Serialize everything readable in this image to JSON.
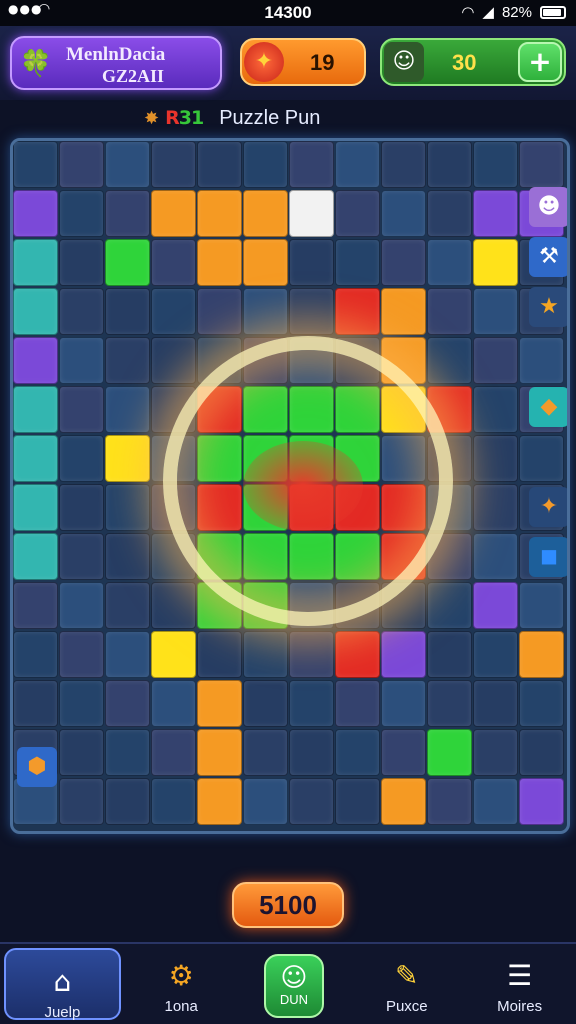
{
  "status_bar": {
    "time": "14300",
    "battery": "82%"
  },
  "header": {
    "player_name": "MenlnDacia",
    "player_code": "GZ2AII",
    "coins": "19",
    "lives": "30",
    "add_symbol": "+"
  },
  "level": {
    "number": "31",
    "prefix": "R",
    "title": "Puzzle Pun"
  },
  "score": "5100",
  "nav": [
    {
      "label": "Juelp",
      "icon": "home-icon"
    },
    {
      "label": "1ona",
      "icon": "gear-icon"
    },
    {
      "label": "DUN",
      "icon": "character-icon"
    },
    {
      "label": "Puxce",
      "icon": "pencil-icon"
    },
    {
      "label": "Moires",
      "icon": "menu-icon"
    }
  ],
  "colors": {
    "orange": "#f59a23",
    "green": "#2fd43a",
    "red": "#e32a24",
    "yellow": "#ffe21a",
    "purple": "#7b49d8",
    "teal": "#33b6b0",
    "blue": "#2d4f7d",
    "board_bg": "#1e3553"
  }
}
